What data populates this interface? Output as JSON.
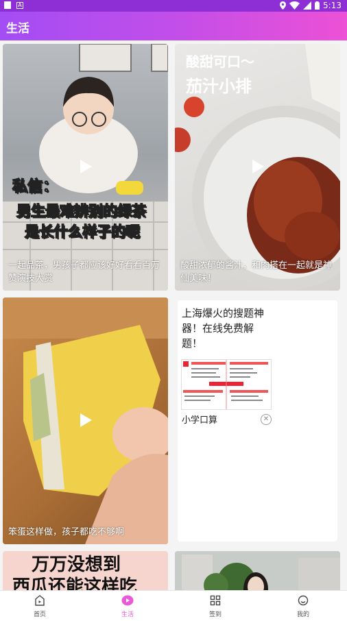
{
  "status_bar": {
    "time": "5:13"
  },
  "app_bar": {
    "title": "生活"
  },
  "feed": [
    {
      "caption": "一起品茶，男孩子都应该好好看看百万赞演技大赏",
      "overlay": [
        "私信：",
        "男生最难辨别的绿茶",
        "是长什么样子的呢"
      ]
    },
    {
      "caption": "酸甜浓郁的酱汁，和肉搭在一起就是神仙美味！",
      "overlay": [
        "酸甜可口～",
        "茄汁小排"
      ]
    },
    {
      "caption": "笨蛋这样做，孩子都吃不够啊",
      "overlay": []
    },
    {
      "caption": "",
      "overlay": [
        "万万没想到",
        "西瓜还能这样吃"
      ]
    },
    {
      "caption": "",
      "overlay": []
    }
  ],
  "ad": {
    "title": "上海爆火的搜题神器！在线免费解题！",
    "source": "小学口算",
    "close_icon": "close-icon"
  },
  "bottom_nav": [
    {
      "label": "首页",
      "icon": "home-play-icon",
      "active": false
    },
    {
      "label": "生活",
      "icon": "life-play-icon",
      "active": true
    },
    {
      "label": "签到",
      "icon": "grid-icon",
      "active": false
    },
    {
      "label": "我的",
      "icon": "smile-icon",
      "active": false
    }
  ],
  "colors": {
    "accent": "#e85ad8",
    "appbar_start": "#a34df4",
    "appbar_end": "#ec51d6"
  }
}
